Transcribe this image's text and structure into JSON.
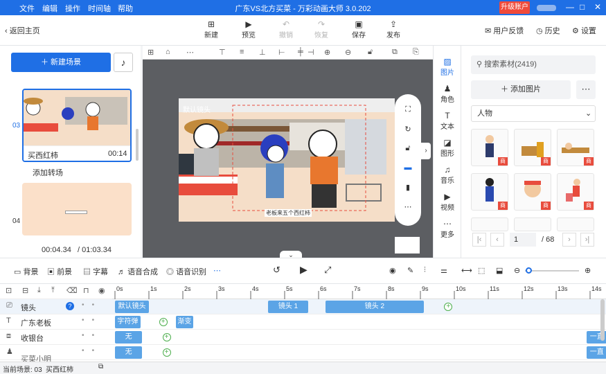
{
  "window": {
    "menu": [
      "文件",
      "编辑",
      "操作",
      "时间轴",
      "帮助"
    ],
    "title": "广东VS北方买菜 - 万彩动画大师 3.0.202",
    "upgrade_label": "升级账户",
    "controls": [
      "—",
      "□",
      "✕"
    ]
  },
  "toolbar": {
    "back_label": "返回主页",
    "buttons": [
      {
        "label": "新建",
        "icon": "new-icon",
        "disabled": false
      },
      {
        "label": "预览",
        "icon": "play-icon",
        "disabled": false
      },
      {
        "label": "撤销",
        "icon": "undo-icon",
        "disabled": true
      },
      {
        "label": "恢复",
        "icon": "redo-icon",
        "disabled": true
      },
      {
        "label": "保存",
        "icon": "save-icon",
        "disabled": false
      },
      {
        "label": "发布",
        "icon": "publish-icon",
        "disabled": false
      }
    ],
    "feedback_label": "用户反馈",
    "history_label": "历史",
    "settings_label": "设置"
  },
  "scenes": {
    "new_scene_label": "新建场景",
    "items": [
      {
        "index": "03",
        "name": "买西红柿",
        "duration": "00:14"
      },
      {
        "index": "04",
        "name": "",
        "duration": ""
      }
    ],
    "add_transition_label": "添加转场",
    "current_time": "00:04.34",
    "total_time": "/ 01:03.34"
  },
  "canvas": {
    "camera_label": "默认镜头",
    "caption": "老板来五个西红柿"
  },
  "right_tabs": [
    "图片",
    "角色",
    "文本",
    "图形",
    "音乐",
    "视频",
    "更多"
  ],
  "assets": {
    "search_placeholder": "搜索素材(2419)",
    "add_label": "添加图片",
    "category": "人物",
    "badge": "商",
    "page": "1",
    "total_pages": "/ 68"
  },
  "bottom_tools": [
    "背景",
    "前景",
    "字幕",
    "语音合成",
    "语音识别"
  ],
  "timeline": {
    "ticks": [
      "0s",
      "1s",
      "2s",
      "3s",
      "4s",
      "5s",
      "6s",
      "7s",
      "8s",
      "9s",
      "10s",
      "11s",
      "12s",
      "13s",
      "14s"
    ],
    "tracks": [
      {
        "name": "镜头",
        "clips": [
          {
            "label": "默认镜头",
            "start": 0,
            "end": 1
          },
          {
            "label": "镜头 1",
            "start": 4.5,
            "end": 5.7
          },
          {
            "label": "镜头 2",
            "start": 6.2,
            "end": 9.1
          }
        ]
      },
      {
        "name": "广东老板",
        "clips": [
          {
            "label": "字符弹",
            "start": 0,
            "end": 0.75
          },
          {
            "label": "渐变",
            "start": 1.8,
            "end": 2.3
          }
        ]
      },
      {
        "name": "收银台",
        "clips": [
          {
            "label": "无",
            "start": 0,
            "end": 0.8
          },
          {
            "label": "一直",
            "start": 13.9,
            "end": 14.5
          }
        ]
      },
      {
        "name": "",
        "clips": [
          {
            "label": "无",
            "start": 0,
            "end": 0.8
          },
          {
            "label": "一直",
            "start": 13.9,
            "end": 14.5
          }
        ]
      }
    ],
    "partial_track_label": "买菜小明"
  },
  "status": {
    "current_scene_label": "当前场景: 03",
    "current_scene_name": "买西红柿"
  },
  "colors": {
    "accent": "#1f6fe5",
    "danger": "#e84c3d",
    "clip": "#5ba4e6",
    "keyframe": "#4cae4c"
  }
}
